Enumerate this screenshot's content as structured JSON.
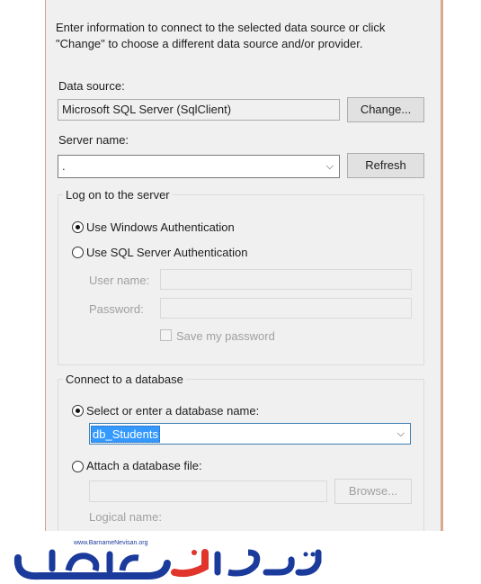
{
  "intro": {
    "line1": "Enter information to connect to the selected data source or click",
    "line2": "\"Change\" to choose a different data source and/or provider."
  },
  "data_source": {
    "label": "Data source:",
    "value": "Microsoft SQL Server (SqlClient)",
    "change_label": "Change..."
  },
  "server": {
    "label": "Server name:",
    "value": ".",
    "refresh_label": "Refresh"
  },
  "logon": {
    "title": "Log on to the server",
    "windows_auth": "Use Windows Authentication",
    "sql_auth": "Use SQL Server Authentication",
    "username_label": "User name:",
    "password_label": "Password:",
    "save_password": "Save my password"
  },
  "database": {
    "title": "Connect to a database",
    "select_label": "Select or enter a database name:",
    "selected_value": "db_Students",
    "attach_label": "Attach a database file:",
    "browse_label": "Browse...",
    "logical_name_label": "Logical name:"
  },
  "logo": {
    "url_text": "www.BarnameNevisan.org",
    "brand_color": "#1a3a9c",
    "accent_color": "#e0342c"
  }
}
